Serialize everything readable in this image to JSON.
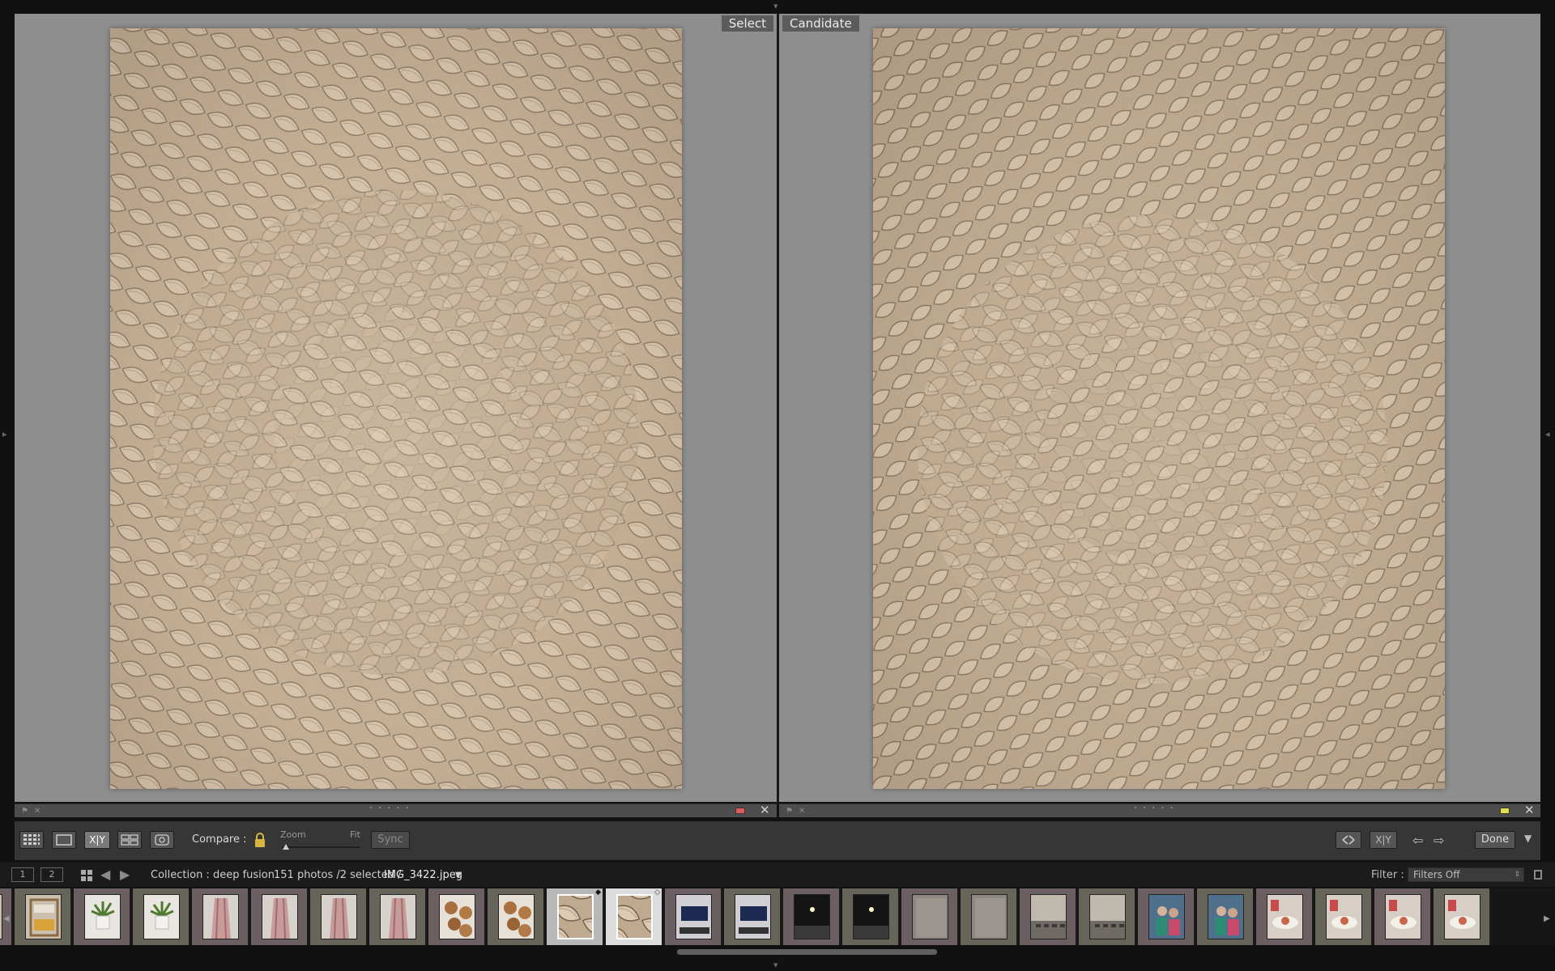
{
  "compare": {
    "select_label": "Select",
    "candidate_label": "Candidate",
    "left_color_label": "#e05b5b",
    "right_color_label": "#e2df4a"
  },
  "toolbar": {
    "compare_label": "Compare :",
    "zoom_label": "Zoom",
    "fit_label": "Fit",
    "sync_label": "Sync",
    "done_label": "Done",
    "xy_label": "X|Y"
  },
  "film_header": {
    "monitor_1": "1",
    "monitor_2": "2",
    "collection": "Collection : deep fusion",
    "count": "151 photos /2 selected /",
    "filename": "IMG_3422.jpeg",
    "filter_label": "Filter :",
    "filter_value": "Filters Off"
  },
  "filmstrip": {
    "thumbs": [
      {
        "kind": "shelf",
        "tone": "c1"
      },
      {
        "kind": "shelf",
        "tone": "c2"
      },
      {
        "kind": "plant",
        "tone": "c1"
      },
      {
        "kind": "plant",
        "tone": "c2"
      },
      {
        "kind": "cloth",
        "tone": "c1"
      },
      {
        "kind": "cloth",
        "tone": "c1"
      },
      {
        "kind": "cloth",
        "tone": "c2"
      },
      {
        "kind": "cloth",
        "tone": "c2"
      },
      {
        "kind": "logs",
        "tone": "c1"
      },
      {
        "kind": "logs",
        "tone": "c2"
      },
      {
        "kind": "weave",
        "tone": "sel"
      },
      {
        "kind": "weave",
        "tone": "cand"
      },
      {
        "kind": "desk",
        "tone": "c1"
      },
      {
        "kind": "desk",
        "tone": "c2"
      },
      {
        "kind": "night",
        "tone": "c1"
      },
      {
        "kind": "night",
        "tone": "c2"
      },
      {
        "kind": "paper",
        "tone": "c1"
      },
      {
        "kind": "paper",
        "tone": "c2"
      },
      {
        "kind": "hall",
        "tone": "c1"
      },
      {
        "kind": "hall",
        "tone": "c2"
      },
      {
        "kind": "people",
        "tone": "c1"
      },
      {
        "kind": "people",
        "tone": "c2"
      },
      {
        "kind": "table",
        "tone": "c1"
      },
      {
        "kind": "table",
        "tone": "c2"
      },
      {
        "kind": "table",
        "tone": "c1"
      },
      {
        "kind": "table",
        "tone": "c2"
      }
    ]
  }
}
